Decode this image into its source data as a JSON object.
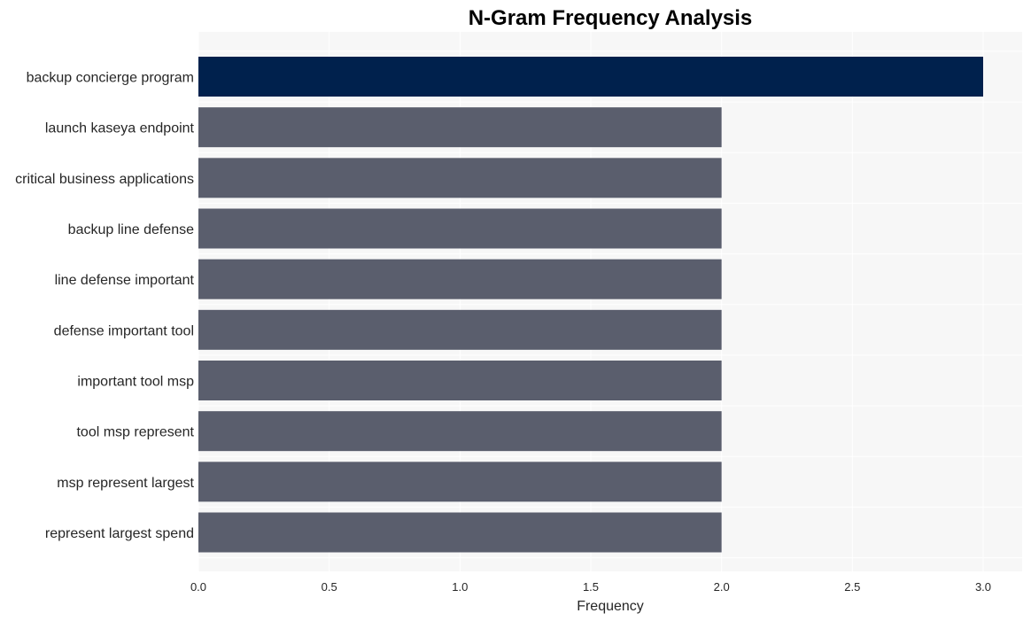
{
  "chart_data": {
    "type": "bar",
    "orientation": "horizontal",
    "title": "N-Gram Frequency Analysis",
    "xlabel": "Frequency",
    "ylabel": "",
    "xlim": [
      0,
      3.15
    ],
    "xticks": [
      0.0,
      0.5,
      1.0,
      1.5,
      2.0,
      2.5,
      3.0
    ],
    "xtick_labels": [
      "0.0",
      "0.5",
      "1.0",
      "1.5",
      "2.0",
      "2.5",
      "3.0"
    ],
    "grid": true,
    "categories": [
      "backup concierge program",
      "launch kaseya endpoint",
      "critical business applications",
      "backup line defense",
      "line defense important",
      "defense important tool",
      "important tool msp",
      "tool msp represent",
      "msp represent largest",
      "represent largest spend"
    ],
    "values": [
      3,
      2,
      2,
      2,
      2,
      2,
      2,
      2,
      2,
      2
    ],
    "colors": {
      "highlight": "#00214d",
      "default": "#5a5e6d",
      "plot_background": "#f7f7f7",
      "grid": "#ffffff"
    }
  }
}
